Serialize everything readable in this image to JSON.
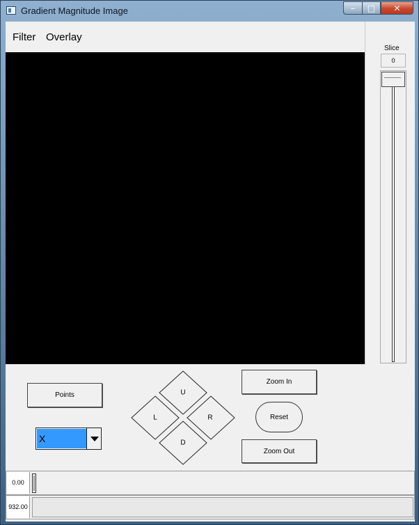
{
  "window": {
    "title": "Gradient Magnitude Image",
    "controls": {
      "minimize": "–",
      "maximize": "□",
      "close": "✕"
    }
  },
  "menu": {
    "items": [
      {
        "label": "Filter"
      },
      {
        "label": "Overlay"
      }
    ]
  },
  "slice": {
    "label": "Slice",
    "value": "0",
    "level": 0
  },
  "controls": {
    "points_label": "Points",
    "axis_select": {
      "selected": "X"
    },
    "dpad": {
      "up": "U",
      "left": "L",
      "right": "R",
      "down": "D"
    },
    "zoom_in_label": "Zoom In",
    "reset_label": "Reset",
    "zoom_out_label": "Zoom Out"
  },
  "bottom": {
    "value_min": "0.00",
    "value_max": "932.00",
    "min_level": 0
  },
  "icons": {
    "app": "window-app-icon",
    "dropdown": "chevron-down-icon"
  },
  "colors": {
    "canvas": "#000000",
    "selection": "#3399ff",
    "close_button": "#c8472c"
  }
}
